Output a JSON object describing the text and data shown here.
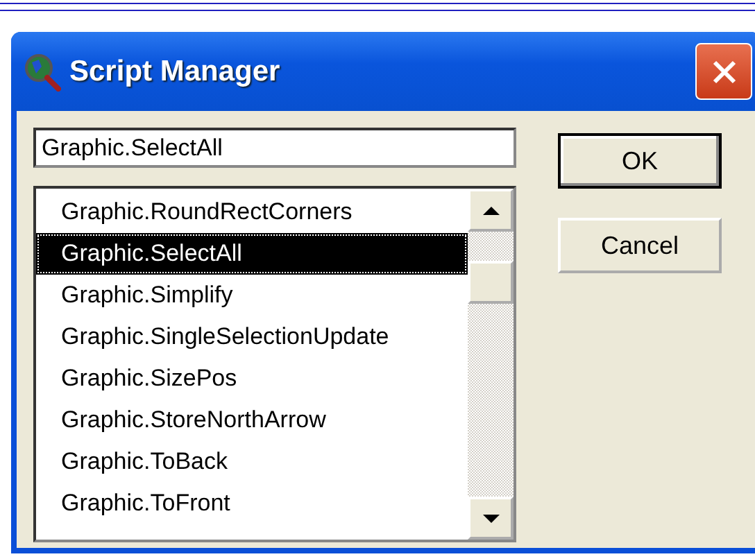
{
  "window": {
    "title": "Script Manager"
  },
  "name_field": {
    "value": "Graphic.SelectAll"
  },
  "scripts": [
    {
      "label": "Graphic.RoundRectCorners",
      "selected": false
    },
    {
      "label": "Graphic.SelectAll",
      "selected": true
    },
    {
      "label": "Graphic.Simplify",
      "selected": false
    },
    {
      "label": "Graphic.SingleSelectionUpdate",
      "selected": false
    },
    {
      "label": "Graphic.SizePos",
      "selected": false
    },
    {
      "label": "Graphic.StoreNorthArrow",
      "selected": false
    },
    {
      "label": "Graphic.ToBack",
      "selected": false
    },
    {
      "label": "Graphic.ToFront",
      "selected": false
    }
  ],
  "buttons": [
    {
      "label": "OK",
      "default": true
    },
    {
      "label": "Cancel",
      "default": false
    }
  ]
}
